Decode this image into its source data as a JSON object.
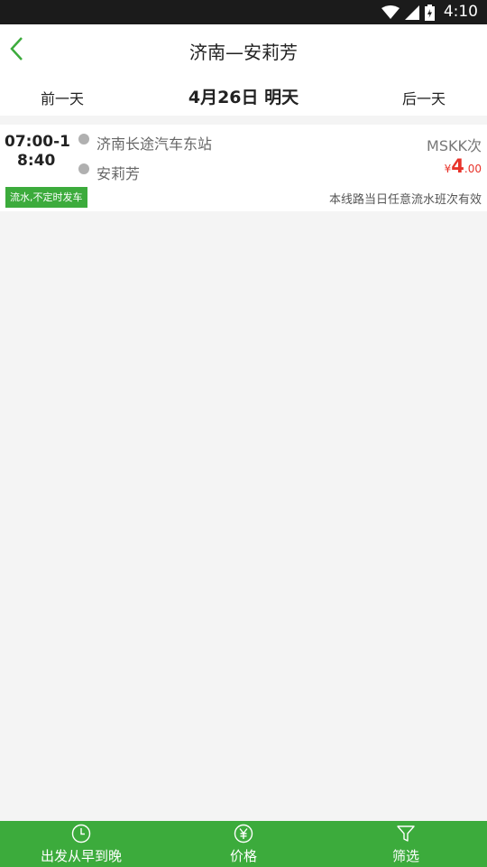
{
  "status_bar": {
    "time": "4:10",
    "icons": [
      "wifi-icon",
      "signal-icon",
      "battery-icon"
    ]
  },
  "header": {
    "title": "济南—安莉芳",
    "back_icon": "chevron-left-icon"
  },
  "date_nav": {
    "prev": "前一天",
    "current": "4月26日 明天",
    "next": "后一天"
  },
  "trips": [
    {
      "time_line1": "07:00-1",
      "time_line2": "8:40",
      "from": "济南长途汽车东站",
      "to": "安莉芳",
      "code": "MSKK次",
      "price_symbol": "¥",
      "price_int": "4",
      "price_dec": ".00",
      "tag": "流水,不定时发车",
      "note": "本线路当日任意流水班次有效"
    }
  ],
  "tabs": [
    {
      "label": "出发从早到晚",
      "icon": "clock-icon"
    },
    {
      "label": "价格",
      "icon": "yen-icon"
    },
    {
      "label": "筛选",
      "icon": "filter-icon"
    }
  ],
  "colors": {
    "accent": "#3cab3c",
    "price": "#e8332a",
    "status_bar": "#1b1b1b"
  }
}
